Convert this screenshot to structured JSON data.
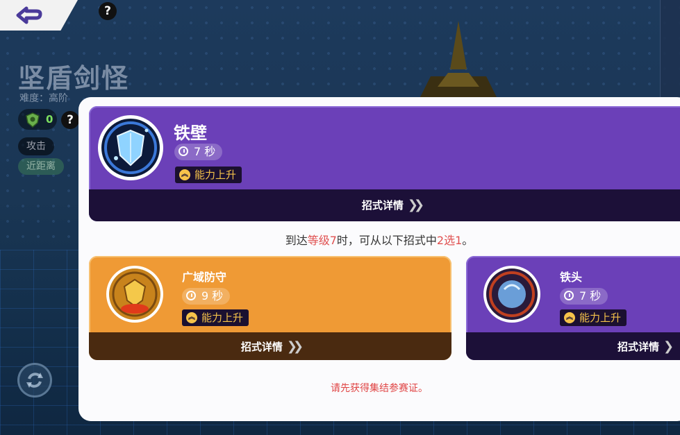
{
  "header": {
    "help_mark": "?"
  },
  "pokemon": {
    "name": "坚盾剑怪",
    "difficulty": "难度：高阶",
    "stat_value": "0",
    "help_mark": "?",
    "tags": [
      "攻击",
      "近距离"
    ]
  },
  "current_move": {
    "name": "铁壁",
    "cooldown": "7 秒",
    "category": "能力上升",
    "details_label": "招式详情"
  },
  "notice": {
    "part1": "到达",
    "level": "等级7",
    "part2": "时，可从以下招式中",
    "choice": "2选1",
    "part3": "。"
  },
  "options": [
    {
      "name": "广域防守",
      "cooldown": "9 秒",
      "category": "能力上升",
      "details_label": "招式详情",
      "color": "#ef9a35"
    },
    {
      "name": "铁头",
      "cooldown": "7 秒",
      "category": "能力上升",
      "details_label": "招式详情",
      "color": "#6b40b8"
    }
  ],
  "warning": "请先获得集结参赛证。",
  "colors": {
    "purple": "#6b40b8",
    "orange": "#ef9a35",
    "highlight_red": "#e05050"
  }
}
